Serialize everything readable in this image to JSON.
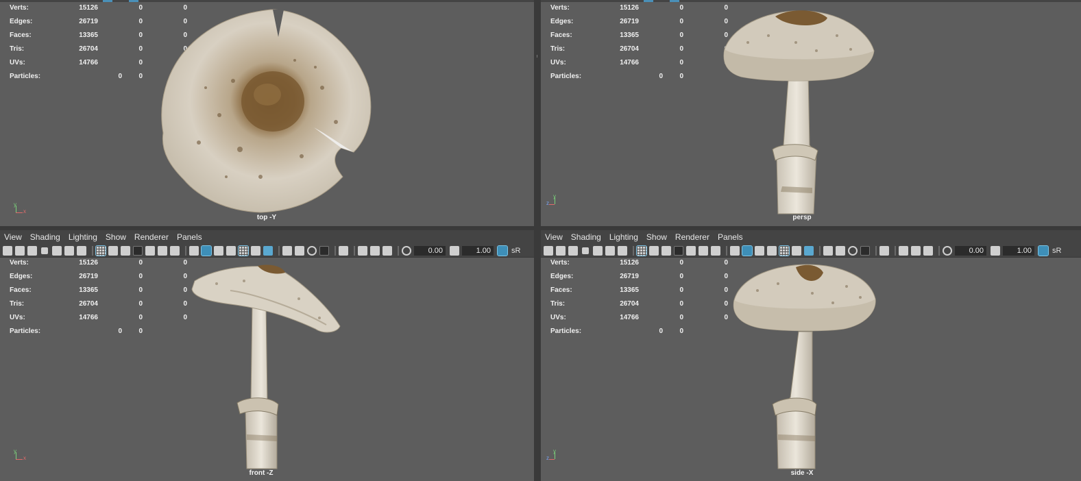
{
  "menu": [
    "View",
    "Shading",
    "Lighting",
    "Show",
    "Renderer",
    "Panels"
  ],
  "toolbar": {
    "field1": "0.00",
    "field2": "1.00",
    "colorspace": "sR"
  },
  "hud": {
    "rows": [
      {
        "label": "Verts:",
        "v1": "15126",
        "v2": "0",
        "v3": "0"
      },
      {
        "label": "Edges:",
        "v1": "26719",
        "v2": "0",
        "v3": "0"
      },
      {
        "label": "Faces:",
        "v1": "13365",
        "v2": "0",
        "v3": "0"
      },
      {
        "label": "Tris:",
        "v1": "26704",
        "v2": "0",
        "v3": "0"
      },
      {
        "label": "UVs:",
        "v1": "14766",
        "v2": "0",
        "v3": "0"
      }
    ],
    "particles": {
      "label": "Particles:",
      "v1": "0",
      "v2": "0"
    }
  },
  "viewports": {
    "top": "top -Y",
    "persp": "persp",
    "front": "front -Z",
    "side": "side -X"
  },
  "axis_labels": {
    "x": "x",
    "y": "y",
    "z": "z"
  },
  "colors": {
    "viewport_bg": "#5d5d5d",
    "menubar_bg": "#444444",
    "active_icon": "#3e8fb8",
    "cap_brown": "#7a5a32",
    "cap_cream": "#d6cfc2",
    "stem": "#e2dcd0"
  },
  "icons": [
    "camera-icon",
    "camera-lock-icon",
    "camera-attr-icon",
    "bookmark-icon",
    "image-plane-icon",
    "2d-pan-icon",
    "grease-pencil-icon",
    "grid-icon",
    "film-gate-icon",
    "resolution-gate-icon",
    "gate-mask-icon",
    "field-chart-icon",
    "safe-action-icon",
    "safe-title-icon",
    "wireframe-icon",
    "smooth-shade-icon",
    "default-material-icon",
    "textured-icon",
    "wireframe-on-shaded-icon",
    "use-all-lights-icon",
    "shadows-icon",
    "screen-space-ao-icon",
    "motion-blur-icon",
    "anti-aliasing-icon",
    "depth-of-field-icon",
    "isolate-select-icon",
    "xray-icon",
    "xray-joints-icon",
    "backface-cull-icon",
    "exposure-icon",
    "gamma-icon",
    "color-management-icon"
  ]
}
